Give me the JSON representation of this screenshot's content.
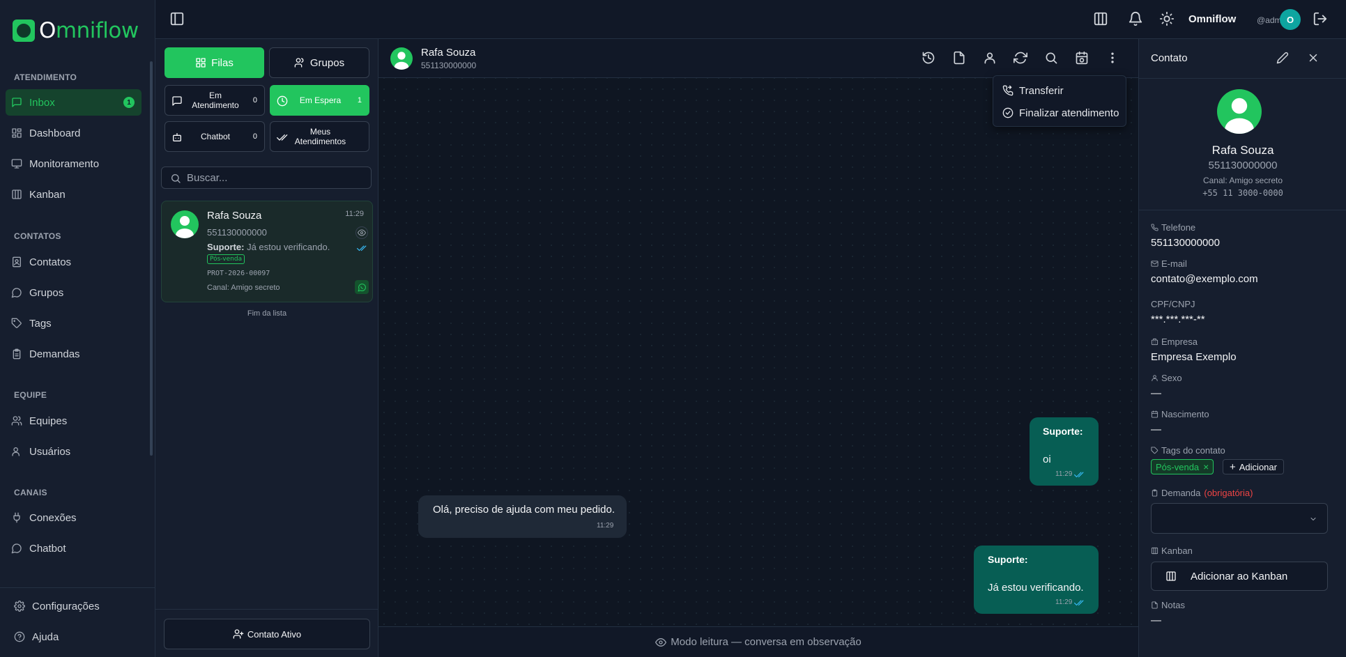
{
  "brand": {
    "logo_first": "O",
    "logo_rest": "mniflow"
  },
  "nav": {
    "sections": [
      {
        "title": "ATENDIMENTO"
      },
      {
        "title": "CONTATOS"
      },
      {
        "title": "EQUIPE"
      },
      {
        "title": "CANAIS"
      }
    ],
    "items": [
      {
        "label": "Inbox",
        "icon": "inbox-icon",
        "badge": "1"
      },
      {
        "label": "Dashboard",
        "icon": "dashboard-icon"
      },
      {
        "label": "Monitoramento",
        "icon": "monitor-icon"
      },
      {
        "label": "Kanban",
        "icon": "kanban-icon"
      },
      {
        "label": "Contatos",
        "icon": "contacts-icon"
      },
      {
        "label": "Grupos",
        "icon": "chat-bubble-icon"
      },
      {
        "label": "Tags",
        "icon": "tag-icon"
      },
      {
        "label": "Demandas",
        "icon": "clipboard-icon"
      },
      {
        "label": "Equipes",
        "icon": "team-icon"
      },
      {
        "label": "Usuários",
        "icon": "user-icon"
      },
      {
        "label": "Conexões",
        "icon": "plug-icon"
      },
      {
        "label": "Chatbot",
        "icon": "bot-icon"
      }
    ],
    "bottom": [
      {
        "label": "Configurações",
        "icon": "gear-icon"
      },
      {
        "label": "Ajuda",
        "icon": "help-icon"
      }
    ]
  },
  "header": {
    "user_name": "Omniflow",
    "user_handle": "@admin",
    "avatar_initial": "O"
  },
  "list": {
    "tabs": [
      {
        "label": "Filas"
      },
      {
        "label": "Grupos"
      }
    ],
    "statuses": [
      {
        "label": "Em Atendimento",
        "count": "0"
      },
      {
        "label": "Em Espera",
        "count": "1"
      },
      {
        "label": "Chatbot",
        "count": "0"
      },
      {
        "label": "Meus Atendimentos",
        "count": ""
      }
    ],
    "search_placeholder": "Buscar...",
    "conversation": {
      "name": "Rafa Souza",
      "time": "11:29",
      "phone": "551130000000",
      "last_sender": "Suporte:",
      "last_message": "Já estou verificando.",
      "tag": "Pós-venda",
      "protocol": "PROT-2026-00097",
      "channel": "Canal: Amigo secreto"
    },
    "end_label": "Fim da lista",
    "active_contact_label": "Contato Ativo"
  },
  "chat": {
    "contact_name": "Rafa Souza",
    "contact_phone": "551130000000",
    "menu": [
      {
        "label": "Transferir"
      },
      {
        "label": "Finalizar atendimento"
      }
    ],
    "messages": [
      {
        "direction": "out",
        "sender": "Suporte:",
        "text": "oi",
        "time": "11:29"
      },
      {
        "direction": "in",
        "text": "Olá, preciso de ajuda com meu pedido.",
        "time": "11:29"
      },
      {
        "direction": "out",
        "sender": "Suporte:",
        "text": "Já estou verificando.",
        "time": "11:29"
      }
    ],
    "footer": "Modo leitura — conversa em observação"
  },
  "contact_panel": {
    "title": "Contato",
    "name": "Rafa Souza",
    "phone": "551130000000",
    "channel": "Canal: Amigo secreto",
    "number": "+55 11 3000-0000",
    "fields": {
      "telefone": {
        "label": "Telefone",
        "value": "551130000000"
      },
      "email": {
        "label": "E-mail",
        "value": "contato@exemplo.com"
      },
      "cpf": {
        "label": "CPF/CNPJ",
        "value": "***.***.***-**"
      },
      "empresa": {
        "label": "Empresa",
        "value": "Empresa Exemplo"
      },
      "sexo": {
        "label": "Sexo",
        "value": "—"
      },
      "nascimento": {
        "label": "Nascimento",
        "value": "—"
      },
      "tags": {
        "label": "Tags do contato",
        "chip": "Pós-venda",
        "add": "Adicionar"
      },
      "demanda": {
        "label": "Demanda",
        "required": "(obrigatória)"
      },
      "kanban": {
        "label": "Kanban",
        "button": "Adicionar ao Kanban"
      },
      "notas": {
        "label": "Notas",
        "value": "—"
      }
    }
  },
  "colors": {
    "accent": "#22c55e",
    "outgoing_bubble": "#075e54",
    "background": "#111827"
  }
}
